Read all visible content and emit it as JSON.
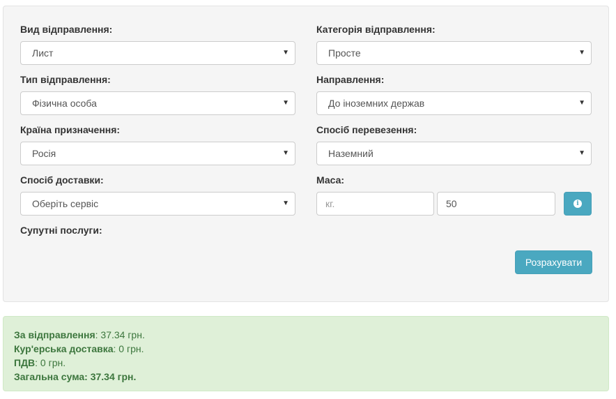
{
  "form": {
    "shipment_type": {
      "label": "Вид відправлення:",
      "value": "Лист"
    },
    "shipment_category": {
      "label": "Категорія відправлення:",
      "value": "Просте"
    },
    "sender_type": {
      "label": "Тип відправлення:",
      "value": "Фізична особа"
    },
    "direction": {
      "label": "Направлення:",
      "value": "До іноземних держав"
    },
    "destination_country": {
      "label": "Країна призначення:",
      "value": "Росія"
    },
    "transport_method": {
      "label": "Спосіб перевезення:",
      "value": "Наземний"
    },
    "delivery_method": {
      "label": "Спосіб доставки:",
      "value": "Оберіть сервіс"
    },
    "mass": {
      "label": "Маса:",
      "unit_placeholder": "кг.",
      "value": "50"
    },
    "extra_services": {
      "label": "Супутні послуги:"
    },
    "calculate_label": "Розрахувати",
    "caret_glyph": "▼",
    "info_glyph": "i"
  },
  "result": {
    "shipment": {
      "label": "За відправлення",
      "value": ": 37.34 грн."
    },
    "courier": {
      "label": "Кур'ерська доставка",
      "value": ": 0 грн."
    },
    "vat": {
      "label": "ПДВ",
      "value": ": 0 грн."
    },
    "total": {
      "label": "Загальна сума: 37.34 грн."
    }
  },
  "colors": {
    "panel_bg": "#f5f5f5",
    "button_info": "#4aa8c0",
    "success_bg": "#dff0d8",
    "success_text": "#3c763d"
  }
}
